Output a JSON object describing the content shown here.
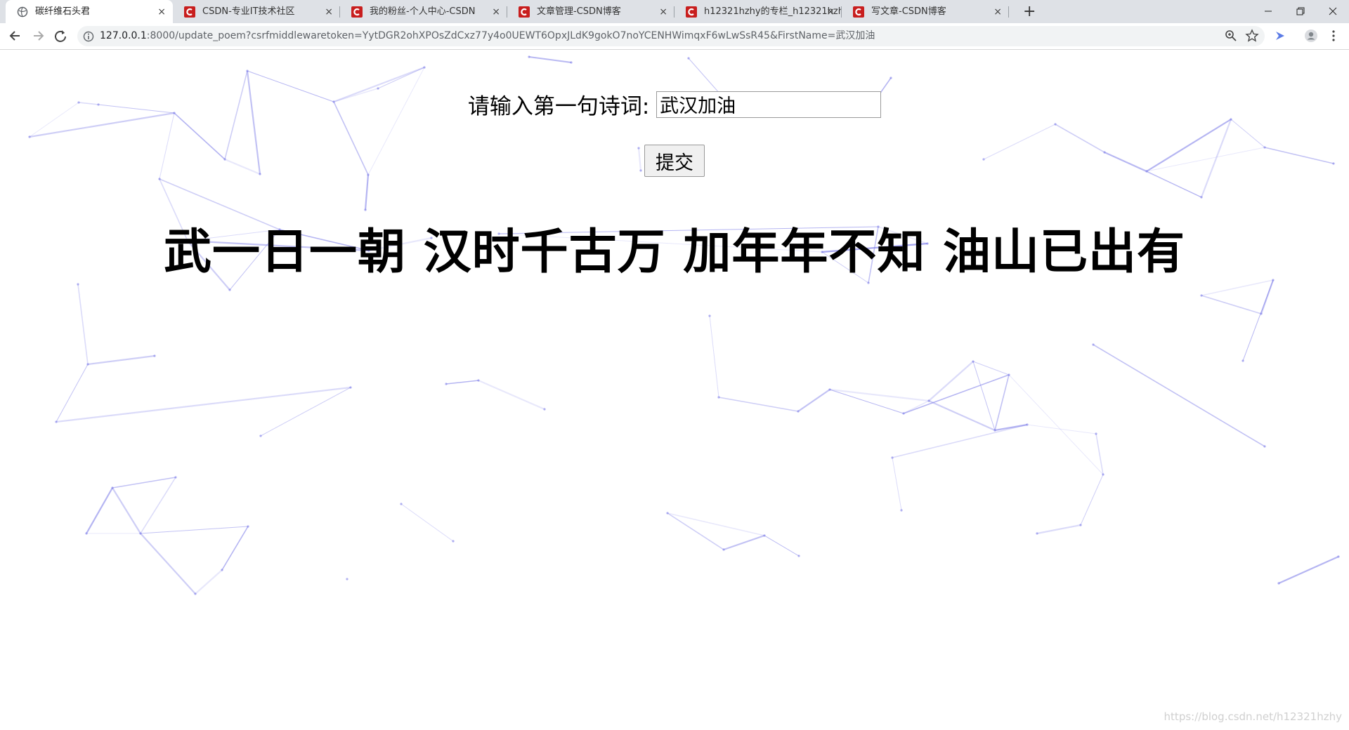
{
  "browser": {
    "tabs": [
      {
        "title": "碳纤维石头君",
        "icon": "globe-icon",
        "active": true
      },
      {
        "title": "CSDN-专业IT技术社区",
        "icon": "csdn-logo-icon",
        "active": false
      },
      {
        "title": "我的粉丝-个人中心-CSDN",
        "icon": "csdn-logo-icon",
        "active": false
      },
      {
        "title": "文章管理-CSDN博客",
        "icon": "csdn-logo-icon",
        "active": false
      },
      {
        "title": "h12321hzhy的专栏_h12321hzh",
        "icon": "csdn-logo-icon",
        "active": false
      },
      {
        "title": "写文章-CSDN博客",
        "icon": "csdn-logo-icon",
        "active": false
      }
    ],
    "close_glyph": "×",
    "new_tab_glyph": "+",
    "address": {
      "host": "127.0.0.1",
      "rest": ":8000/update_poem?csrfmiddlewaretoken=YytDGR2ohXPOsZdCxz77y4o0UEWT6OpxJLdK9gokO7noYCENHWimqxF6wLwSsR45&FirstName=武汉加油"
    }
  },
  "form": {
    "label": "请输入第一句诗词:",
    "input_value": "武汉加油",
    "submit_label": "提交"
  },
  "poem": "武一日一朝 汉时千古万 加年年不知 油山已出有",
  "watermark": "https://blog.csdn.net/h12321hzhy",
  "colors": {
    "network_line": "#7f7fe8",
    "csdn_red": "#c81e1e"
  }
}
